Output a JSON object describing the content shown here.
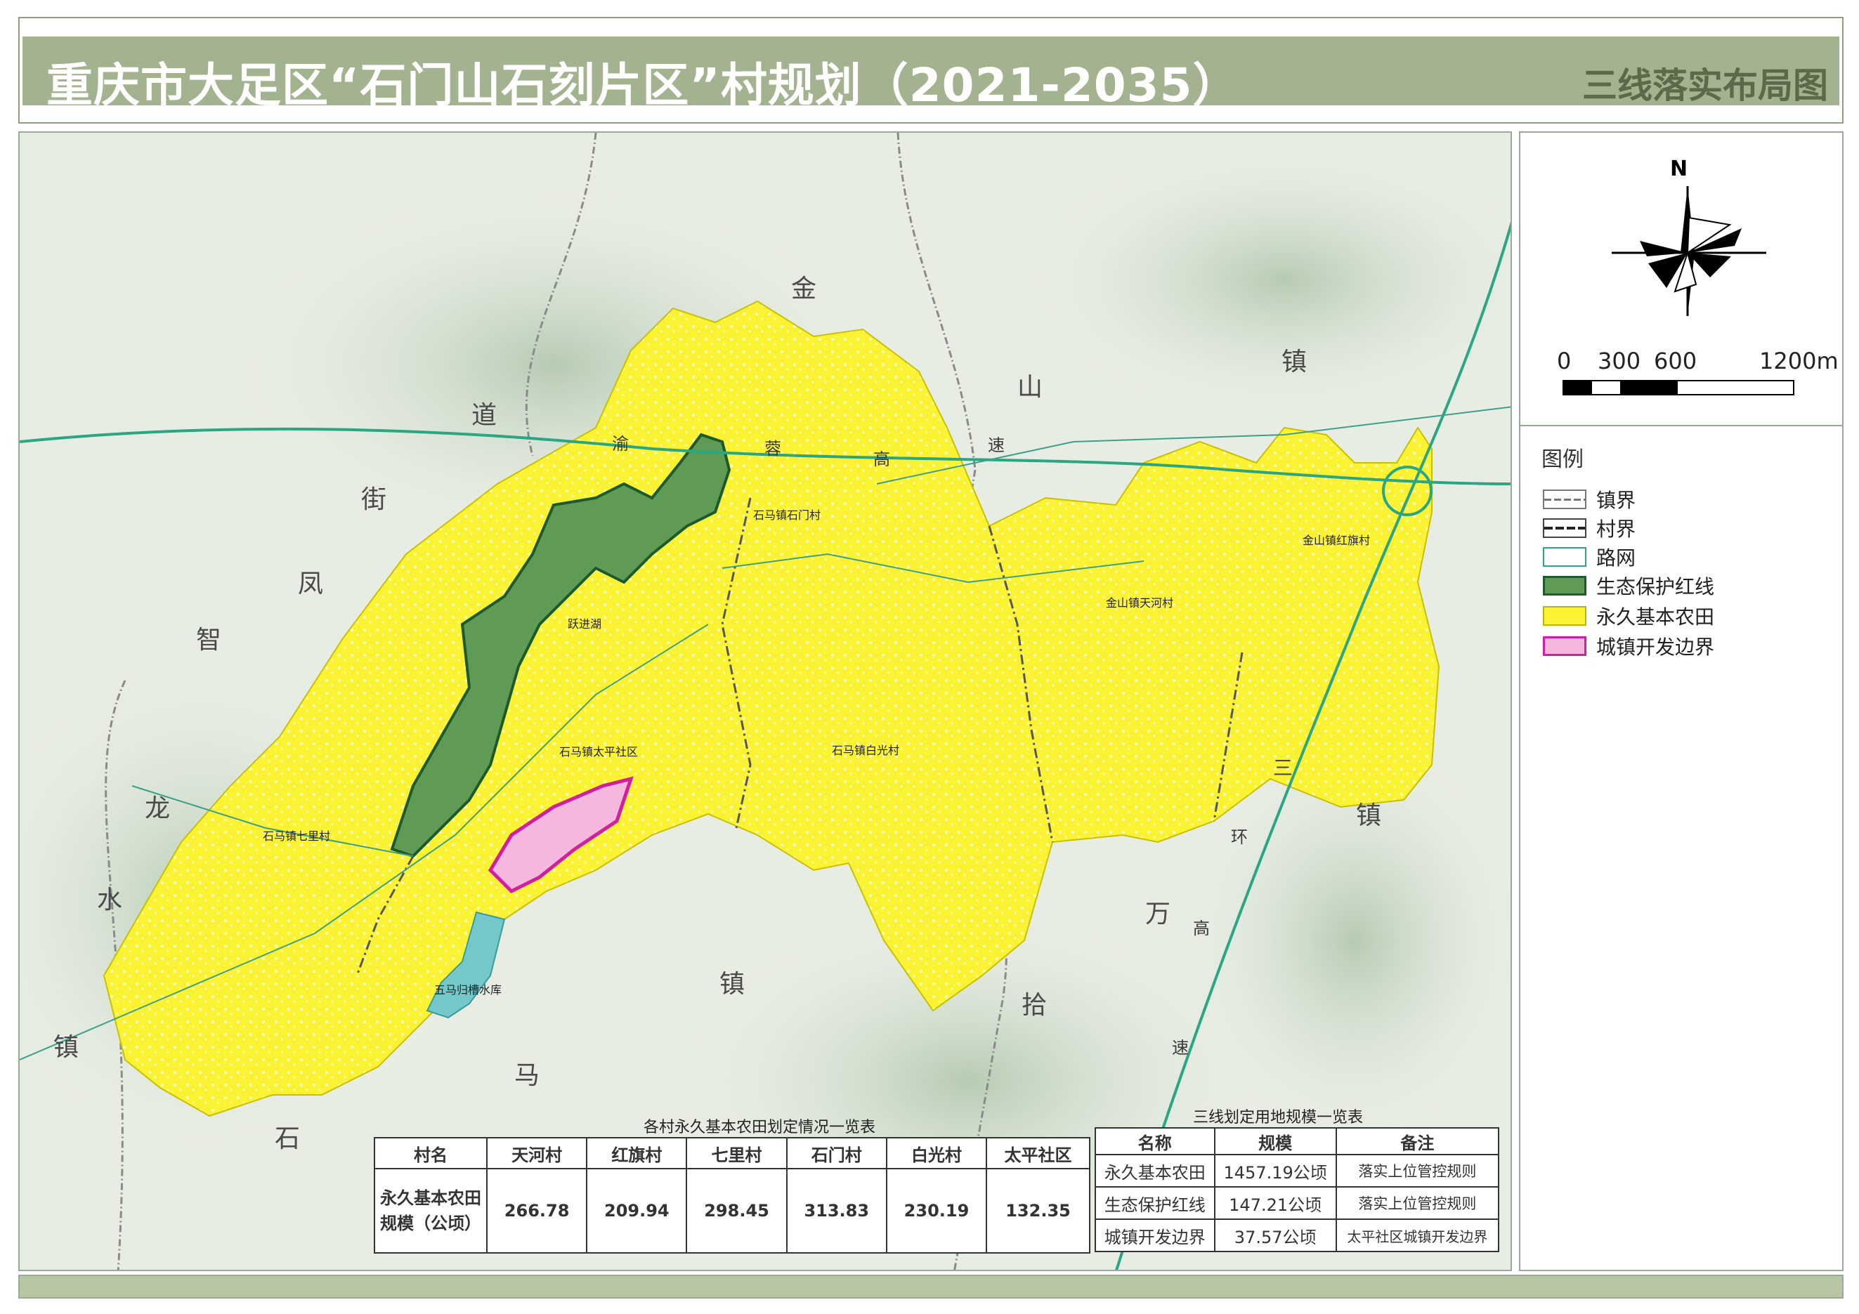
{
  "header": {
    "title": "重庆市大足区“石门山石刻片区”村规划（2021-2035）",
    "map_type": "三线落实布局图"
  },
  "north_arrow": {
    "label": "N"
  },
  "scale_bar": {
    "labels": [
      "0",
      "300",
      "600",
      "1200m"
    ]
  },
  "legend": {
    "title": "图例",
    "items": [
      {
        "label": "镇界",
        "fill": "#ffffff",
        "stroke": "#777777"
      },
      {
        "label": "村界",
        "fill": "#ffffff",
        "stroke": "#444444"
      },
      {
        "label": "路网",
        "fill": "#ffffff",
        "stroke": "#2aa684"
      },
      {
        "label": "生态保护红线",
        "fill": "#5f9b55",
        "stroke": "#1e5a2a"
      },
      {
        "label": "永久基本农田",
        "fill": "#fbf233",
        "stroke": "#b8b800"
      },
      {
        "label": "城镇开发边界",
        "fill": "#f6b7df",
        "stroke": "#d020a0"
      }
    ]
  },
  "map_labels": {
    "villages": [
      {
        "text": "石马镇石门村"
      },
      {
        "text": "金山镇红旗村"
      },
      {
        "text": "金山镇天河村"
      },
      {
        "text": "石马镇太平社区"
      },
      {
        "text": "石马镇白光村"
      },
      {
        "text": "石马镇七里村"
      },
      {
        "text": "五马归槽水库"
      },
      {
        "text": "跃进湖"
      }
    ],
    "place_chars": [
      "金",
      "山",
      "镇",
      "道",
      "街",
      "凤",
      "智",
      "龙",
      "水",
      "镇",
      "石",
      "马",
      "镇",
      "拾",
      "万",
      "镇",
      "三"
    ],
    "road_chars": [
      "渝",
      "蓉",
      "高",
      "速",
      "环",
      "高",
      "速"
    ]
  },
  "table_farmland": {
    "caption": "各村永久基本农田划定情况一览表",
    "headers": [
      "村名",
      "天河村",
      "红旗村",
      "七里村",
      "石门村",
      "白光村",
      "太平社区"
    ],
    "row_label": "永久基本农田规模（公顷）",
    "values": [
      "266.78",
      "209.94",
      "298.45",
      "313.83",
      "230.19",
      "132.35"
    ]
  },
  "table_three_lines": {
    "caption": "三线划定用地规模一览表",
    "headers": [
      "名称",
      "规模",
      "备注"
    ],
    "rows": [
      [
        "永久基本农田",
        "1457.19公顷",
        "落实上位管控规则"
      ],
      [
        "生态保护红线",
        "147.21公顷",
        "落实上位管控规则"
      ],
      [
        "城镇开发边界",
        "37.57公顷",
        "太平社区城镇开发边界"
      ]
    ]
  },
  "colors": {
    "farmland": "#fbf233",
    "ecological": "#5f9b55",
    "urban": "#f6b7df",
    "road": "#2aa684",
    "terrain_light": "#e6ece2",
    "terrain_dark": "#b9cdb6"
  }
}
